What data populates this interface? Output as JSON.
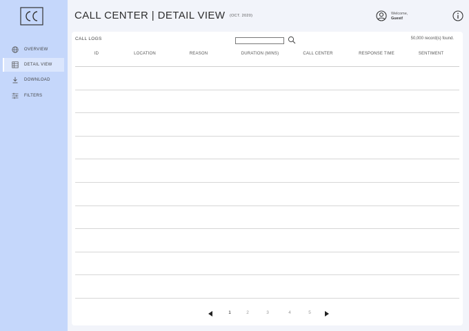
{
  "brand": {
    "logo_text": "CC"
  },
  "sidebar": {
    "items": [
      {
        "label": "OVERVIEW",
        "icon": "globe-icon"
      },
      {
        "label": "DETAIL VIEW",
        "icon": "table-icon",
        "active": true
      },
      {
        "label": "DOWNLOAD",
        "icon": "download-icon"
      },
      {
        "label": "FILTERS",
        "icon": "sliders-icon"
      }
    ]
  },
  "header": {
    "title": "CALL CENTER | DETAIL VIEW",
    "subtitle": "(OCT. 2020)",
    "welcome": "Welcome,",
    "user": "Guest!"
  },
  "logs": {
    "title": "CALL LOGS",
    "search_value": "",
    "record_count": "50,000 record(s) found.",
    "columns": [
      "ID",
      "LOCATION",
      "REASON",
      "DURATION (MINS)",
      "CALL CENTER",
      "RESPONSE TIME",
      "SENTIMENT"
    ],
    "rows": [
      [],
      [],
      [],
      [],
      [],
      [],
      [],
      [],
      [],
      []
    ]
  },
  "pagination": {
    "pages": [
      "1",
      "2",
      "3",
      "4",
      "5"
    ],
    "current": "1"
  },
  "colors": {
    "sidebar_bg": "#c5d7fb",
    "active_nav_bg": "#dbe6fd",
    "page_bg": "#f2f4fa",
    "card_bg": "#ffffff"
  }
}
